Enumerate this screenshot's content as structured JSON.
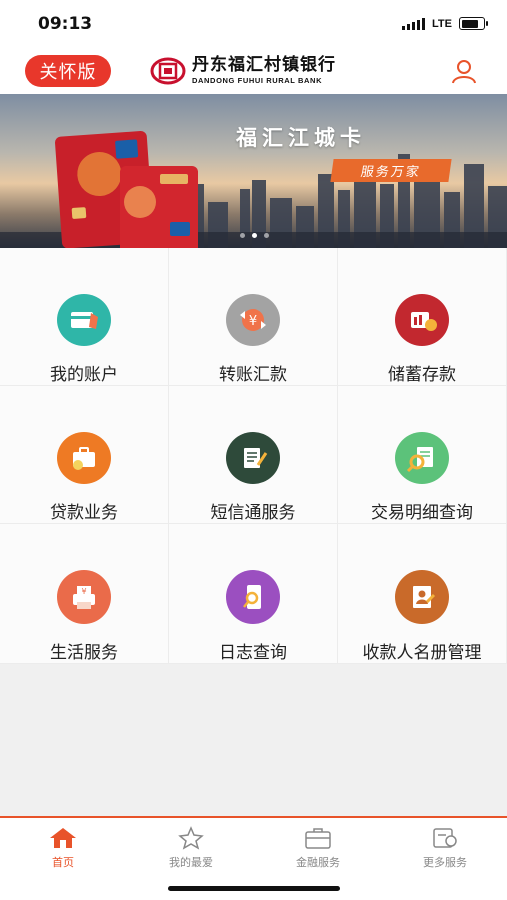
{
  "status_bar": {
    "time": "09:13",
    "network": "LTE"
  },
  "header": {
    "care_mode_label": "关怀版",
    "bank_name_cn": "丹东福汇村镇银行",
    "bank_name_en": "DANDONG FUHUI RURAL BANK",
    "icons": {
      "logo": "bank-logo-icon",
      "user": "user-icon"
    }
  },
  "banner": {
    "title": "福汇江城卡",
    "slogan": "服务万家",
    "slides_count": 3,
    "active_slide": 1
  },
  "menu": {
    "items": [
      {
        "label": "我的账户",
        "icon": "account-card-icon",
        "color": "#2fb6a8"
      },
      {
        "label": "转账汇款",
        "icon": "transfer-yuan-icon",
        "color": "#9b9b9b"
      },
      {
        "label": "储蓄存款",
        "icon": "savings-deposit-icon",
        "color": "#c2282f"
      },
      {
        "label": "贷款业务",
        "icon": "loan-briefcase-icon",
        "color": "#ee7a24"
      },
      {
        "label": "短信通服务",
        "icon": "sms-notepad-icon",
        "color": "#2e4a3a"
      },
      {
        "label": "交易明细查询",
        "icon": "transaction-search-icon",
        "color": "#5cc27a"
      },
      {
        "label": "生活服务",
        "icon": "life-service-printer-icon",
        "color": "#ea6b4a"
      },
      {
        "label": "日志查询",
        "icon": "log-search-phone-icon",
        "color": "#9b4fc0"
      },
      {
        "label": "收款人名册管理",
        "icon": "payee-register-icon",
        "color": "#c96a2a"
      }
    ]
  },
  "tab_bar": {
    "active_color": "#e8532a",
    "tabs": [
      {
        "label": "首页",
        "icon": "home-icon",
        "active": true
      },
      {
        "label": "我的最爱",
        "icon": "star-icon",
        "active": false
      },
      {
        "label": "金融服务",
        "icon": "briefcase-icon",
        "active": false
      },
      {
        "label": "更多服务",
        "icon": "more-services-icon",
        "active": false
      }
    ]
  }
}
